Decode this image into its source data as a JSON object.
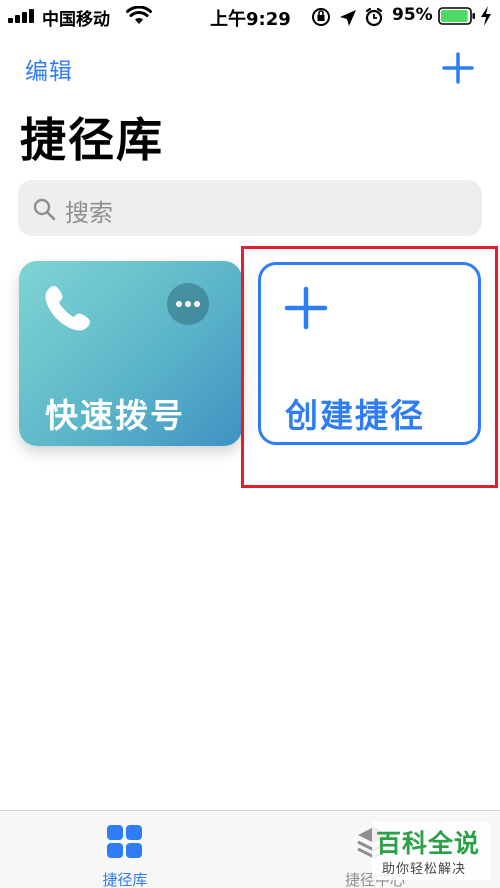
{
  "status_bar": {
    "carrier": "中国移动",
    "time": "上午9:29",
    "battery_percent": "95%",
    "battery_level": 0.95,
    "icons": [
      "signal-icon",
      "wifi-icon",
      "orientation-lock-icon",
      "location-icon",
      "alarm-icon",
      "battery-icon",
      "charging-icon"
    ]
  },
  "nav": {
    "edit_label": "编辑",
    "add_icon": "plus-icon"
  },
  "title": "捷径库",
  "search": {
    "placeholder": "搜索"
  },
  "cards": {
    "speed_dial": {
      "label": "快速拨号",
      "icon": "phone-icon",
      "gradient": [
        "#7fd4d3",
        "#3f91c2"
      ]
    },
    "create": {
      "label": "创建捷径",
      "icon": "plus-icon"
    }
  },
  "tab_bar": {
    "tabs": [
      {
        "label": "捷径库",
        "icon": "grid-icon",
        "active": true
      },
      {
        "label": "捷径中心",
        "icon": "stack-icon",
        "active": false
      }
    ]
  },
  "watermark": {
    "main": "百科全说",
    "sub": "助你轻松解决"
  },
  "colors": {
    "accent": "#2e7cf6",
    "annotation": "#e0202a",
    "battery": "#4cd964"
  }
}
